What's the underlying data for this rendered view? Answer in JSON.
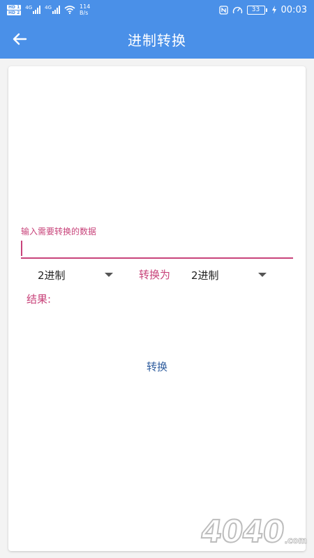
{
  "status_bar": {
    "sim1": "HD 1",
    "sim2": "HD 2",
    "net1": "4G",
    "net2": "4G",
    "speed_value": "114",
    "speed_unit": "B/s",
    "battery": "33",
    "time": "00:03"
  },
  "app_bar": {
    "title": "进制转换",
    "back_icon": "arrow-left-icon"
  },
  "form": {
    "input_label": "输入需要转换的数据",
    "input_value": "",
    "from_select": "2进制",
    "convert_to_label": "转换为",
    "to_select": "2进制",
    "result_label": "结果:",
    "convert_button": "转换"
  },
  "watermark": {
    "text": "4040",
    "suffix": ".com"
  },
  "colors": {
    "primary": "#4a90e8",
    "accent": "#c8437a",
    "button_text": "#2f5d9e"
  }
}
